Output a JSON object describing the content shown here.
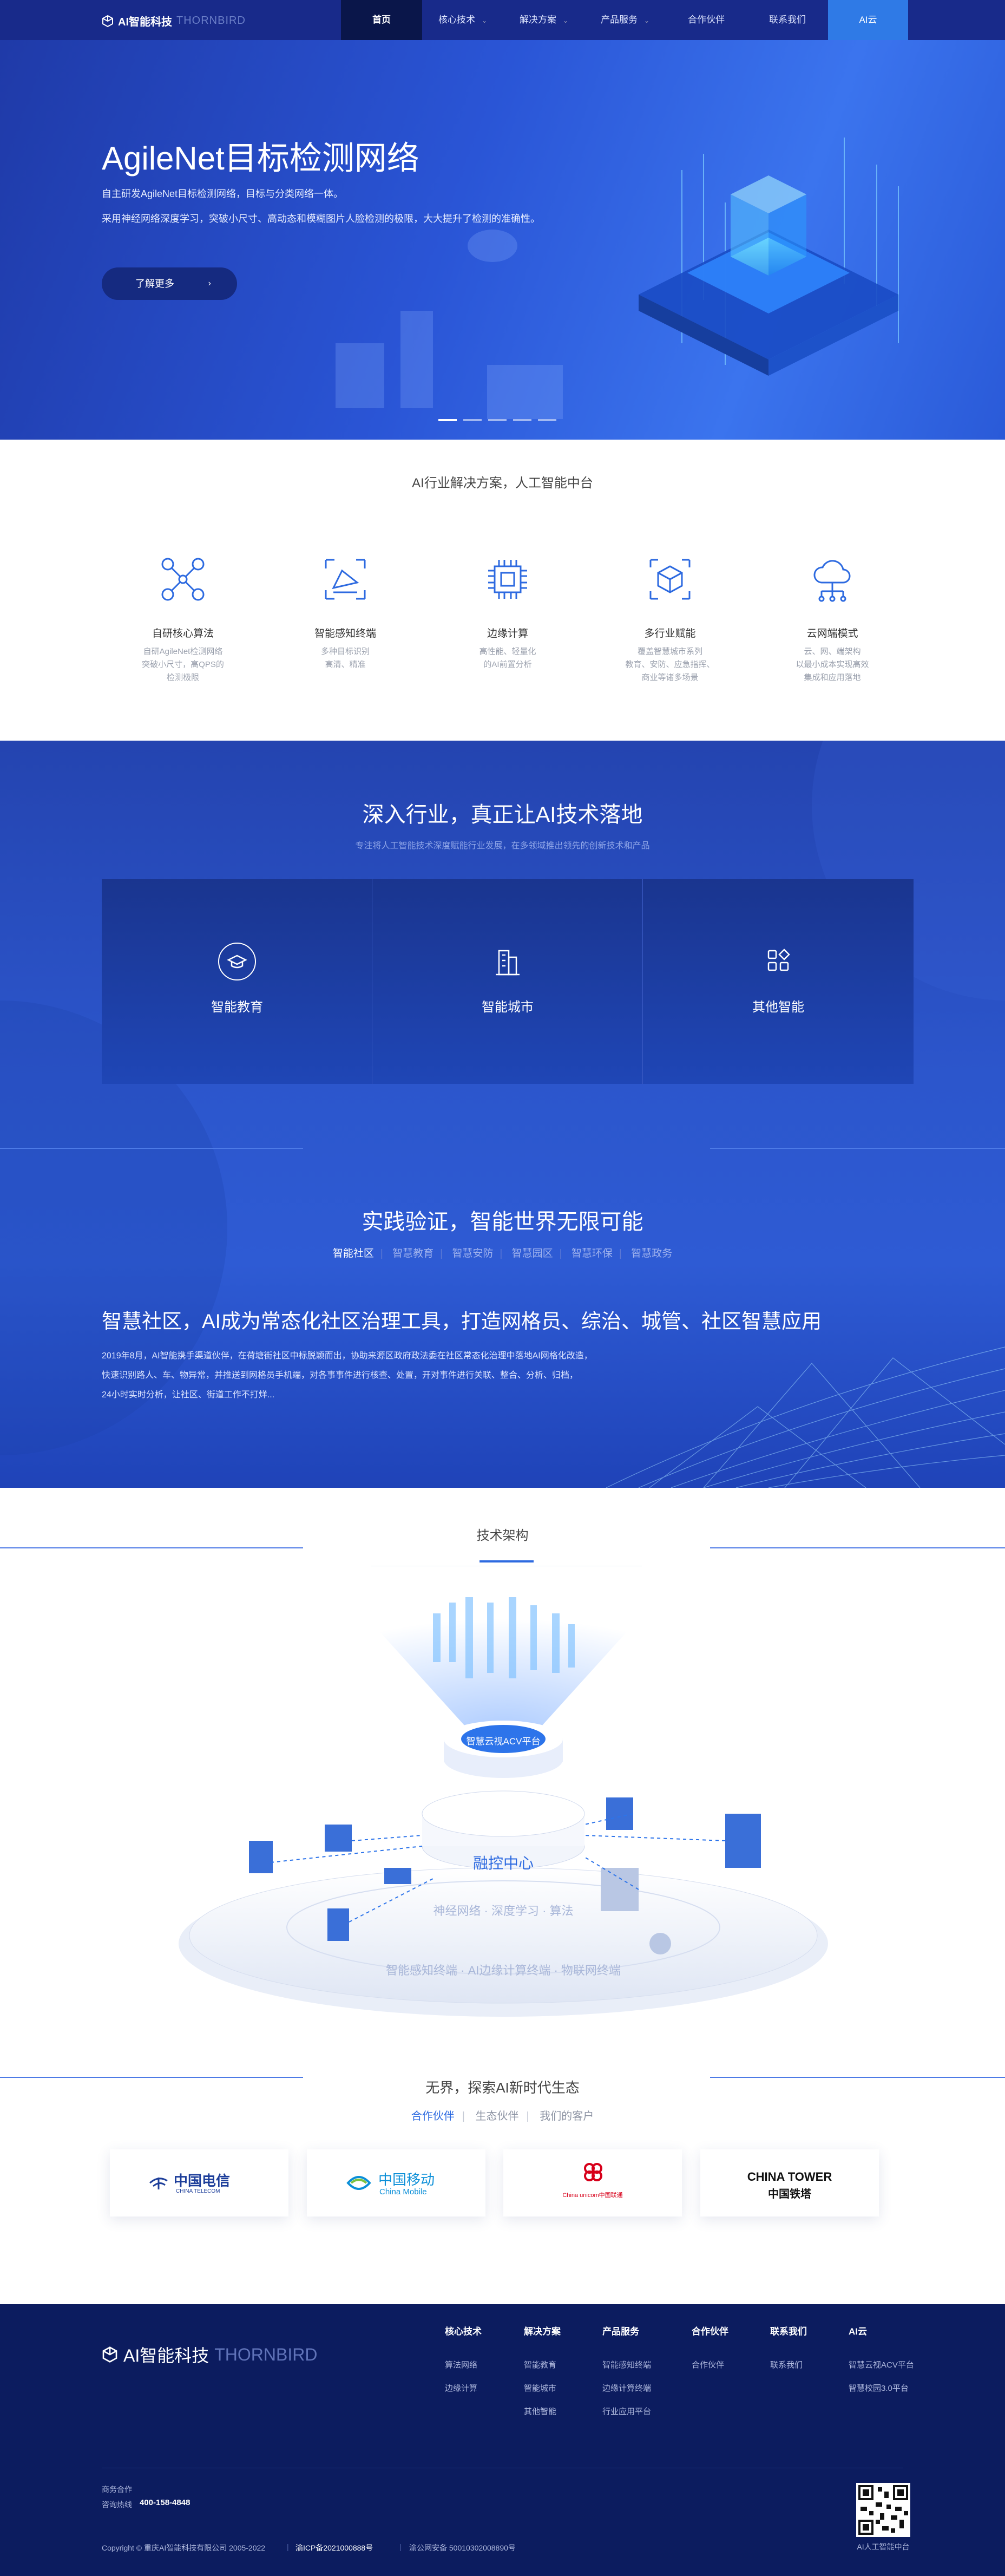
{
  "header": {
    "logo_text": "AI智能科技",
    "logo_en": "THORNBIRD",
    "nav": [
      {
        "label": "首页",
        "active": true
      },
      {
        "label": "核心技术",
        "dropdown": true
      },
      {
        "label": "解决方案",
        "dropdown": true
      },
      {
        "label": "产品服务",
        "dropdown": true
      },
      {
        "label": "合作伙伴"
      },
      {
        "label": "联系我们"
      },
      {
        "label": "AI云",
        "highlight": true
      }
    ]
  },
  "hero": {
    "title": "AgileNet目标检测网络",
    "desc1": "自主研发AgileNet目标检测网络，目标与分类网络一体。",
    "desc2": "采用神经网络深度学习，突破小尺寸、高动态和模糊图片人脸检测的极限，大大提升了检测的准确性。",
    "button": "了解更多",
    "slides": 5,
    "active_slide": 1
  },
  "solutions": {
    "title": "AI行业解决方案，人工智能中台",
    "items": [
      {
        "icon": "neural-algorithm-icon",
        "name": "自研核心算法",
        "desc": "自研AgileNet检测网络\n突破小尺寸，高QPS的\n检测极限"
      },
      {
        "icon": "camera-sensing-icon",
        "name": "智能感知终端",
        "desc": "多种目标识别\n高清、精准"
      },
      {
        "icon": "chip-icon",
        "name": "边缘计算",
        "desc": "高性能、轻量化\n的AI前置分析"
      },
      {
        "icon": "cube-scan-icon",
        "name": "多行业赋能",
        "desc": "覆盖智慧城市系列\n教育、安防、应急指挥、\n商业等诸多场景"
      },
      {
        "icon": "cloud-network-icon",
        "name": "云网端模式",
        "desc": "云、网、端架构\n以最小成本实现高效\n集成和应用落地"
      }
    ]
  },
  "industry": {
    "title": "深入行业，真正让AI技术落地",
    "subtitle": "专注将人工智能技术深度赋能行业发展，在多领域推出领先的创新技术和产品",
    "cards": [
      {
        "icon": "graduation-cap-icon",
        "label": "智能教育"
      },
      {
        "icon": "city-buildings-icon",
        "label": "智能城市"
      },
      {
        "icon": "apps-grid-icon",
        "label": "其他智能"
      }
    ]
  },
  "practice": {
    "title": "实践验证，智能世界无限可能",
    "tabs": [
      "智能社区",
      "智慧教育",
      "智慧安防",
      "智慧园区",
      "智慧环保",
      "智慧政务"
    ],
    "active_tab": 0,
    "case_title": "智慧社区，AI成为常态化社区治理工具，打造网格员、综治、城管、社区智慧应用",
    "paragraphs": [
      "2019年8月，AI智能携手渠道伙伴，在荷塘街社区中标脱颖而出，协助来源区政府政法委在社区常态化治理中落地AI网格化改造，",
      "快速识别路人、车、物异常，并推送到网格员手机端，对各事事件进行核查、处置，开对事件进行关联、整合、分析、归档，",
      "24小时实时分析，让社区、街道工作不打烊..."
    ]
  },
  "architecture": {
    "title": "技术架构",
    "platform_label": "智慧云视ACV平台",
    "hub_label": "融控中心",
    "ring1": "神经网络 · 深度学习 · 算法",
    "ring2": "智能感知终端 · AI边缘计算终端 · 物联网终端"
  },
  "partners": {
    "title": "无界，探索AI新时代生态",
    "tabs": [
      "合作伙伴",
      "生态伙伴",
      "我们的客户"
    ],
    "active_tab": 0,
    "logos": [
      {
        "name": "中国电信",
        "en": "CHINA TELECOM",
        "color": "#1d3e9a"
      },
      {
        "name": "中国移动",
        "en": "China Mobile",
        "color": "#0b8fd8"
      },
      {
        "name": "中国联通",
        "en": "China unicom中国联通",
        "color": "#d7001a"
      },
      {
        "name": "中国铁塔",
        "en": "CHINA TOWER",
        "color": "#111111"
      }
    ]
  },
  "footer": {
    "logo_text": "AI智能科技",
    "logo_en": "THORNBIRD",
    "columns": [
      {
        "title": "核心技术",
        "links": [
          "算法网络",
          "边缘计算"
        ]
      },
      {
        "title": "解决方案",
        "links": [
          "智能教育",
          "智能城市",
          "其他智能"
        ]
      },
      {
        "title": "产品服务",
        "links": [
          "智能感知终端",
          "边缘计算终端",
          "行业应用平台"
        ]
      },
      {
        "title": "合作伙伴",
        "links": [
          "合作伙伴"
        ]
      },
      {
        "title": "联系我们",
        "links": [
          "联系我们"
        ]
      },
      {
        "title": "AI云",
        "links": [
          "智慧云视ACV平台",
          "智慧校园3.0平台"
        ]
      }
    ],
    "business": "商务合作",
    "hotline_label": "咨询热线",
    "hotline": "400-158-4848",
    "copyright": "Copyright © 重庆AI智能科技有限公司 2005-2022",
    "icp": "渝ICP备2021000888号",
    "police": "渝公网安备 50010302008890号",
    "qr_caption": "AI人工智能中台"
  }
}
